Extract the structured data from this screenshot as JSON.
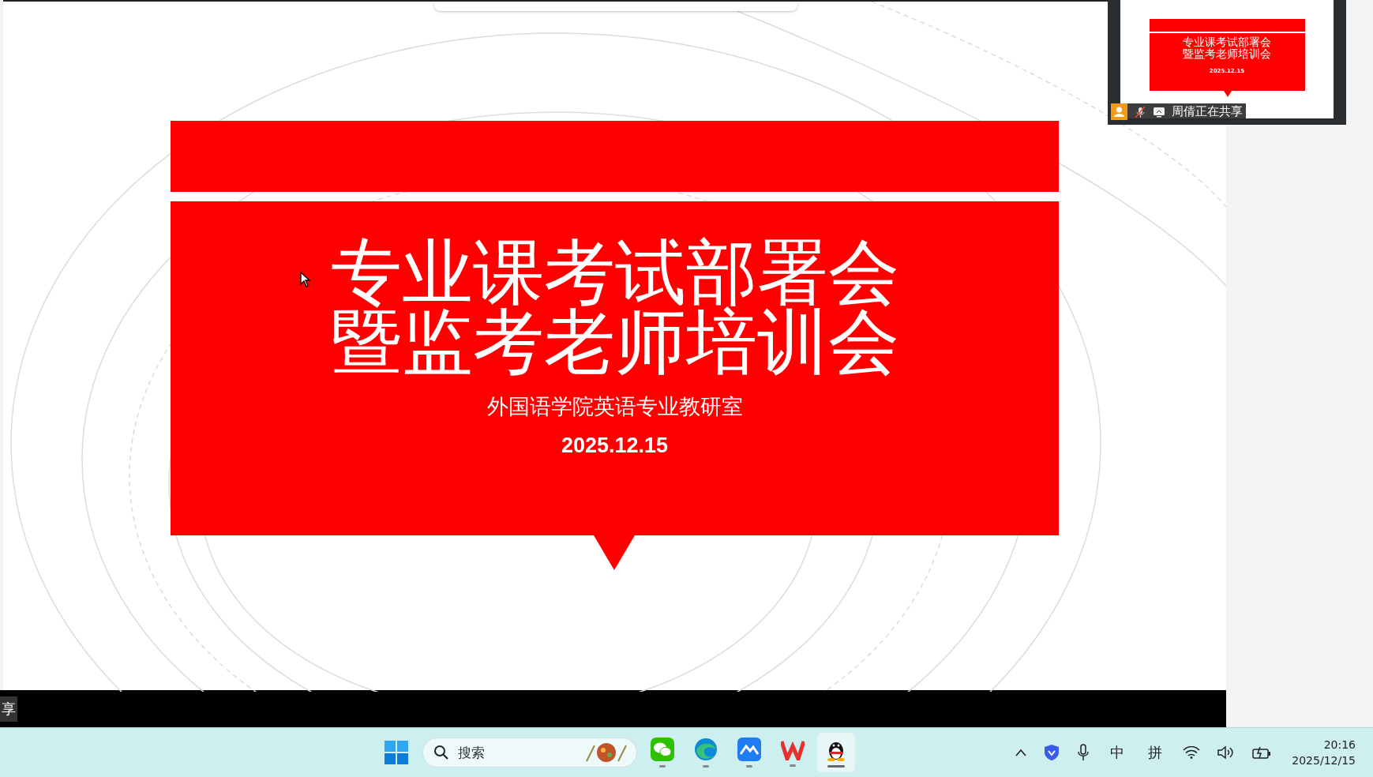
{
  "slide": {
    "title_lines": [
      "专业课考试部署会",
      "暨监考老师培训会"
    ],
    "subtitle": "外国语学院英语专业教研室",
    "date": "2025.12.15"
  },
  "thumbnail": {
    "title_lines": [
      "专业课考试部署会",
      "暨监考老师培训会"
    ],
    "date": "2025.12.15",
    "sharer": "周倩正在共享"
  },
  "share_label": "享",
  "taskbar": {
    "search": {
      "placeholder": "搜索"
    },
    "apps": [
      {
        "kind": "wechat",
        "selected": false
      },
      {
        "kind": "edge",
        "selected": false
      },
      {
        "kind": "feishu",
        "selected": false
      },
      {
        "kind": "wps",
        "selected": false
      },
      {
        "kind": "qq",
        "selected": true
      }
    ],
    "ime_mode": "中",
    "ime_name": "拼",
    "time": "20:16",
    "date": "2025/12/15"
  }
}
